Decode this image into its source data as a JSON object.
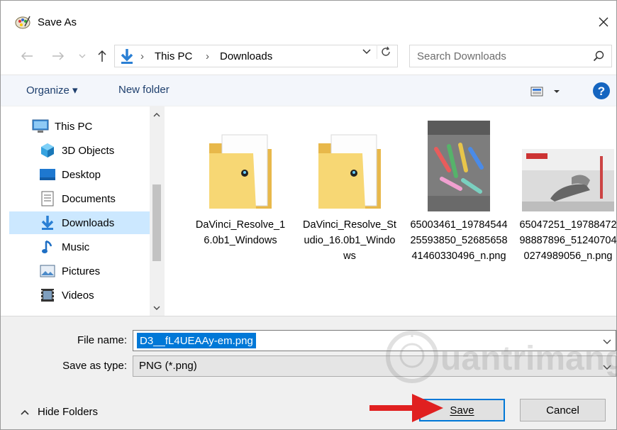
{
  "window": {
    "title": "Save As",
    "title_icon": "paint-palette-icon",
    "close_icon": "close-icon"
  },
  "navigation": {
    "back_icon": "arrow-left-icon",
    "forward_icon": "arrow-right-icon",
    "recent_icon": "chevron-down-icon",
    "up_icon": "arrow-up-icon",
    "breadcrumb": [
      "This PC",
      "Downloads"
    ],
    "refresh_icon": "refresh-icon",
    "search_placeholder": "Search Downloads"
  },
  "toolbar": {
    "organize_label": "Organize ▾",
    "new_folder_label": "New folder",
    "view_icon": "view-options-icon",
    "help_icon": "help-icon"
  },
  "sidebar": {
    "items": [
      {
        "label": "This PC",
        "icon": "computer-icon"
      },
      {
        "label": "3D Objects",
        "icon": "cube-icon"
      },
      {
        "label": "Desktop",
        "icon": "desktop-icon"
      },
      {
        "label": "Documents",
        "icon": "document-icon"
      },
      {
        "label": "Downloads",
        "icon": "download-icon",
        "selected": true
      },
      {
        "label": "Music",
        "icon": "music-icon"
      },
      {
        "label": "Pictures",
        "icon": "pictures-icon"
      },
      {
        "label": "Videos",
        "icon": "videos-icon"
      }
    ]
  },
  "files": [
    {
      "name": "DaVinci_Resolve_16.0b1_Windows",
      "type": "folder"
    },
    {
      "name": "DaVinci_Resolve_Studio_16.0b1_Windows",
      "type": "folder"
    },
    {
      "name": "65003461_1978454425593850_5268565841460330496_n.png",
      "type": "image"
    },
    {
      "name": "65047251_1978847298887896_512407040274989056_n.png",
      "type": "image"
    }
  ],
  "form": {
    "file_name_label": "File name:",
    "file_name_value": "D3__fL4UEAAy-em.png",
    "save_type_label": "Save as type:",
    "save_type_value": "PNG (*.png)",
    "hide_folders_label": "Hide Folders",
    "save_label": "Save",
    "cancel_label": "Cancel"
  },
  "colors": {
    "accent": "#0078d7",
    "selection": "#cce8ff",
    "folder": "#f7d774",
    "arrow": "#e02020"
  },
  "watermark": "uantrimang"
}
